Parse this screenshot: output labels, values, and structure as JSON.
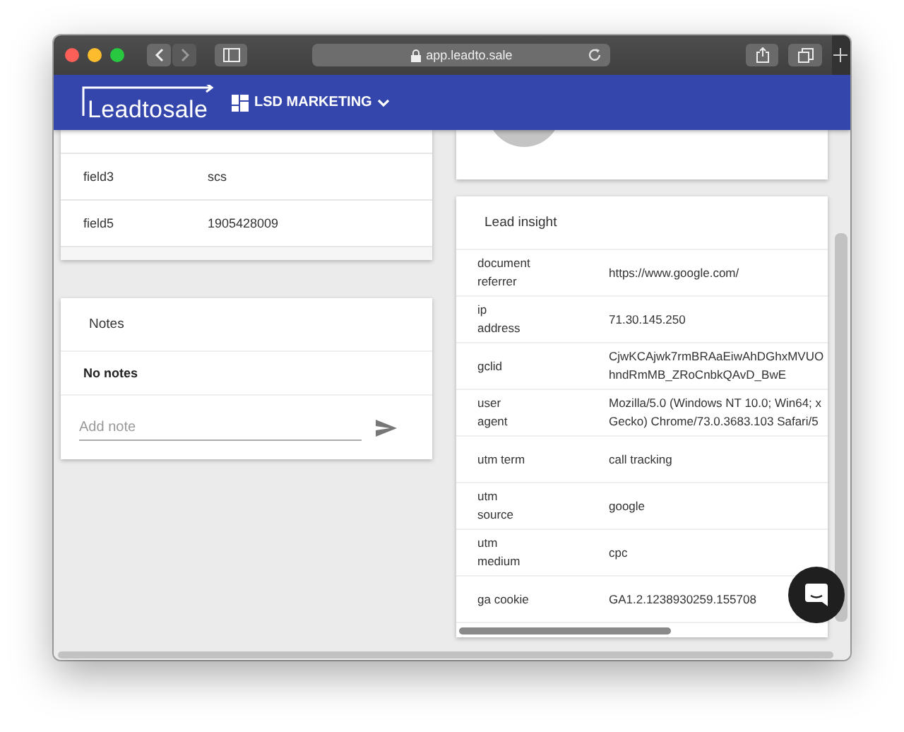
{
  "browser": {
    "url": "app.leadto.sale"
  },
  "header": {
    "logo": "Leadtosale",
    "workspace": "LSD MARKETING"
  },
  "fields_card": {
    "rows": [
      {
        "label": "field3",
        "value": "scs"
      },
      {
        "label": "field5",
        "value": "1905428009"
      }
    ]
  },
  "notes": {
    "title": "Notes",
    "empty_text": "No notes",
    "input": {
      "placeholder": "Add note"
    }
  },
  "lead_insight": {
    "title": "Lead insight",
    "rows": [
      {
        "label": "document\nreferrer",
        "value": "https://www.google.com/"
      },
      {
        "label": "ip\naddress",
        "value": "71.30.145.250"
      },
      {
        "label": "gclid",
        "value": "CjwKCAjwk7rmBRAaEiwAhDGhxMVUO\nhndRmMB_ZRoCnbkQAvD_BwE"
      },
      {
        "label": "user\nagent",
        "value": "Mozilla/5.0 (Windows NT 10.0; Win64; x\nGecko) Chrome/73.0.3683.103 Safari/5"
      },
      {
        "label": "utm term",
        "value": "call tracking"
      },
      {
        "label": "utm\nsource",
        "value": "google"
      },
      {
        "label": "utm\nmedium",
        "value": "cpc"
      },
      {
        "label": "ga cookie",
        "value": "GA1.2.1238930259.155708"
      }
    ]
  }
}
